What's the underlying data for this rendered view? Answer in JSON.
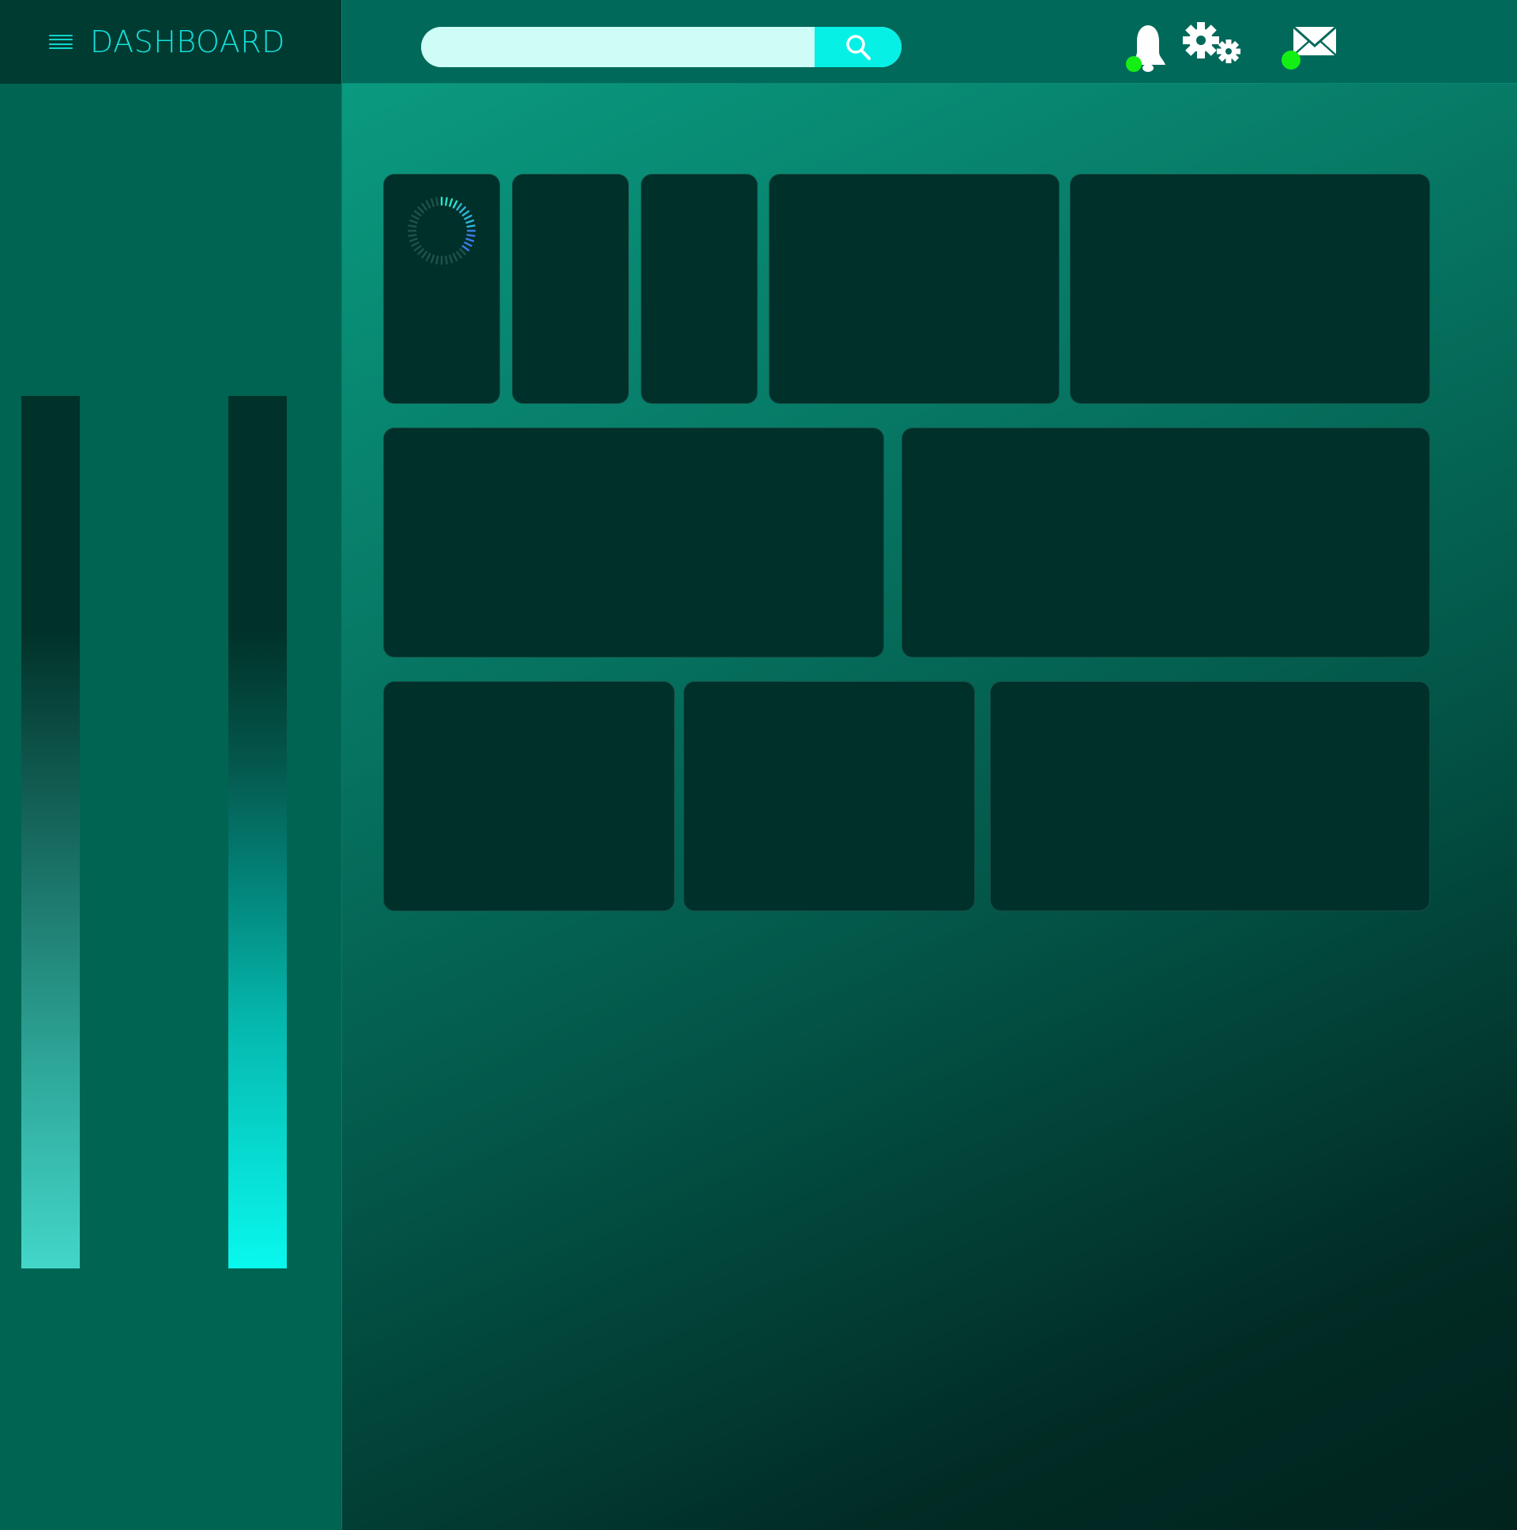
{
  "app": {
    "title": "DASHBOARD"
  },
  "search": {
    "placeholder": "",
    "value": ""
  },
  "icons": {
    "menu": "menu-icon",
    "search": "search-icon",
    "bell": "bell-icon",
    "gears": "gears-icon",
    "mail": "mail-icon"
  },
  "colors": {
    "accent": "#13e0d8",
    "status_dot": "#13ef13",
    "card": "#00302a",
    "sidebar": "#006453"
  },
  "notifications": {
    "has_unread": true
  },
  "messages": {
    "has_unread": true
  },
  "sidebar_bars": [
    {
      "name": "bar-1"
    },
    {
      "name": "bar-2"
    }
  ],
  "cards": {
    "row1": [
      "card-1",
      "card-2",
      "card-3",
      "card-4",
      "card-5"
    ],
    "row2": [
      "card-6",
      "card-7"
    ],
    "row3": [
      "card-8",
      "card-9",
      "card-10"
    ]
  }
}
